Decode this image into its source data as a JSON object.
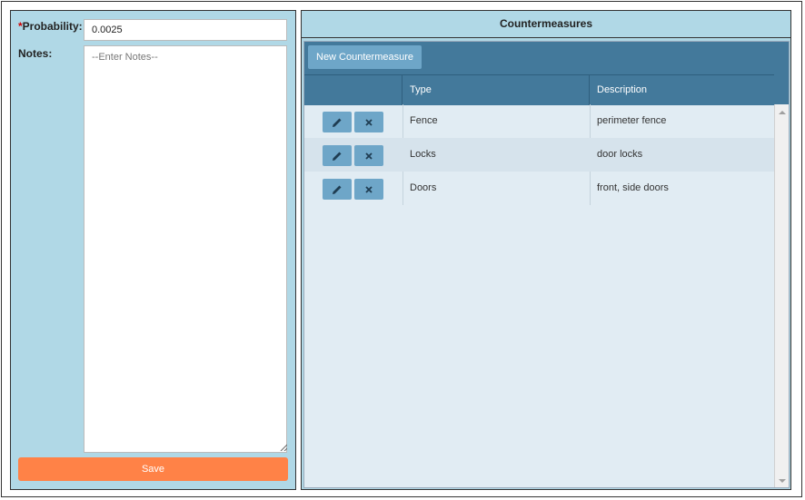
{
  "form": {
    "probability_required_mark": "*",
    "probability_label": "Probability:",
    "probability_value": "0.0025",
    "notes_label": "Notes:",
    "notes_placeholder": "--Enter Notes--",
    "save_label": "Save"
  },
  "countermeasures": {
    "title": "Countermeasures",
    "new_button_label": "New Countermeasure",
    "columns": [
      "",
      "Type",
      "Description"
    ],
    "rows": [
      {
        "type": "Fence",
        "description": "perimeter fence"
      },
      {
        "type": "Locks",
        "description": "door locks"
      },
      {
        "type": "Doors",
        "description": "front, side doors"
      }
    ],
    "row_actions": {
      "edit_icon": "pencil-icon",
      "delete_icon": "close-icon"
    }
  },
  "colors": {
    "panel_bg": "#b0d8e6",
    "grid_header": "#43799b",
    "button_blue": "#6ea6c8",
    "save_orange": "#ff8247"
  }
}
